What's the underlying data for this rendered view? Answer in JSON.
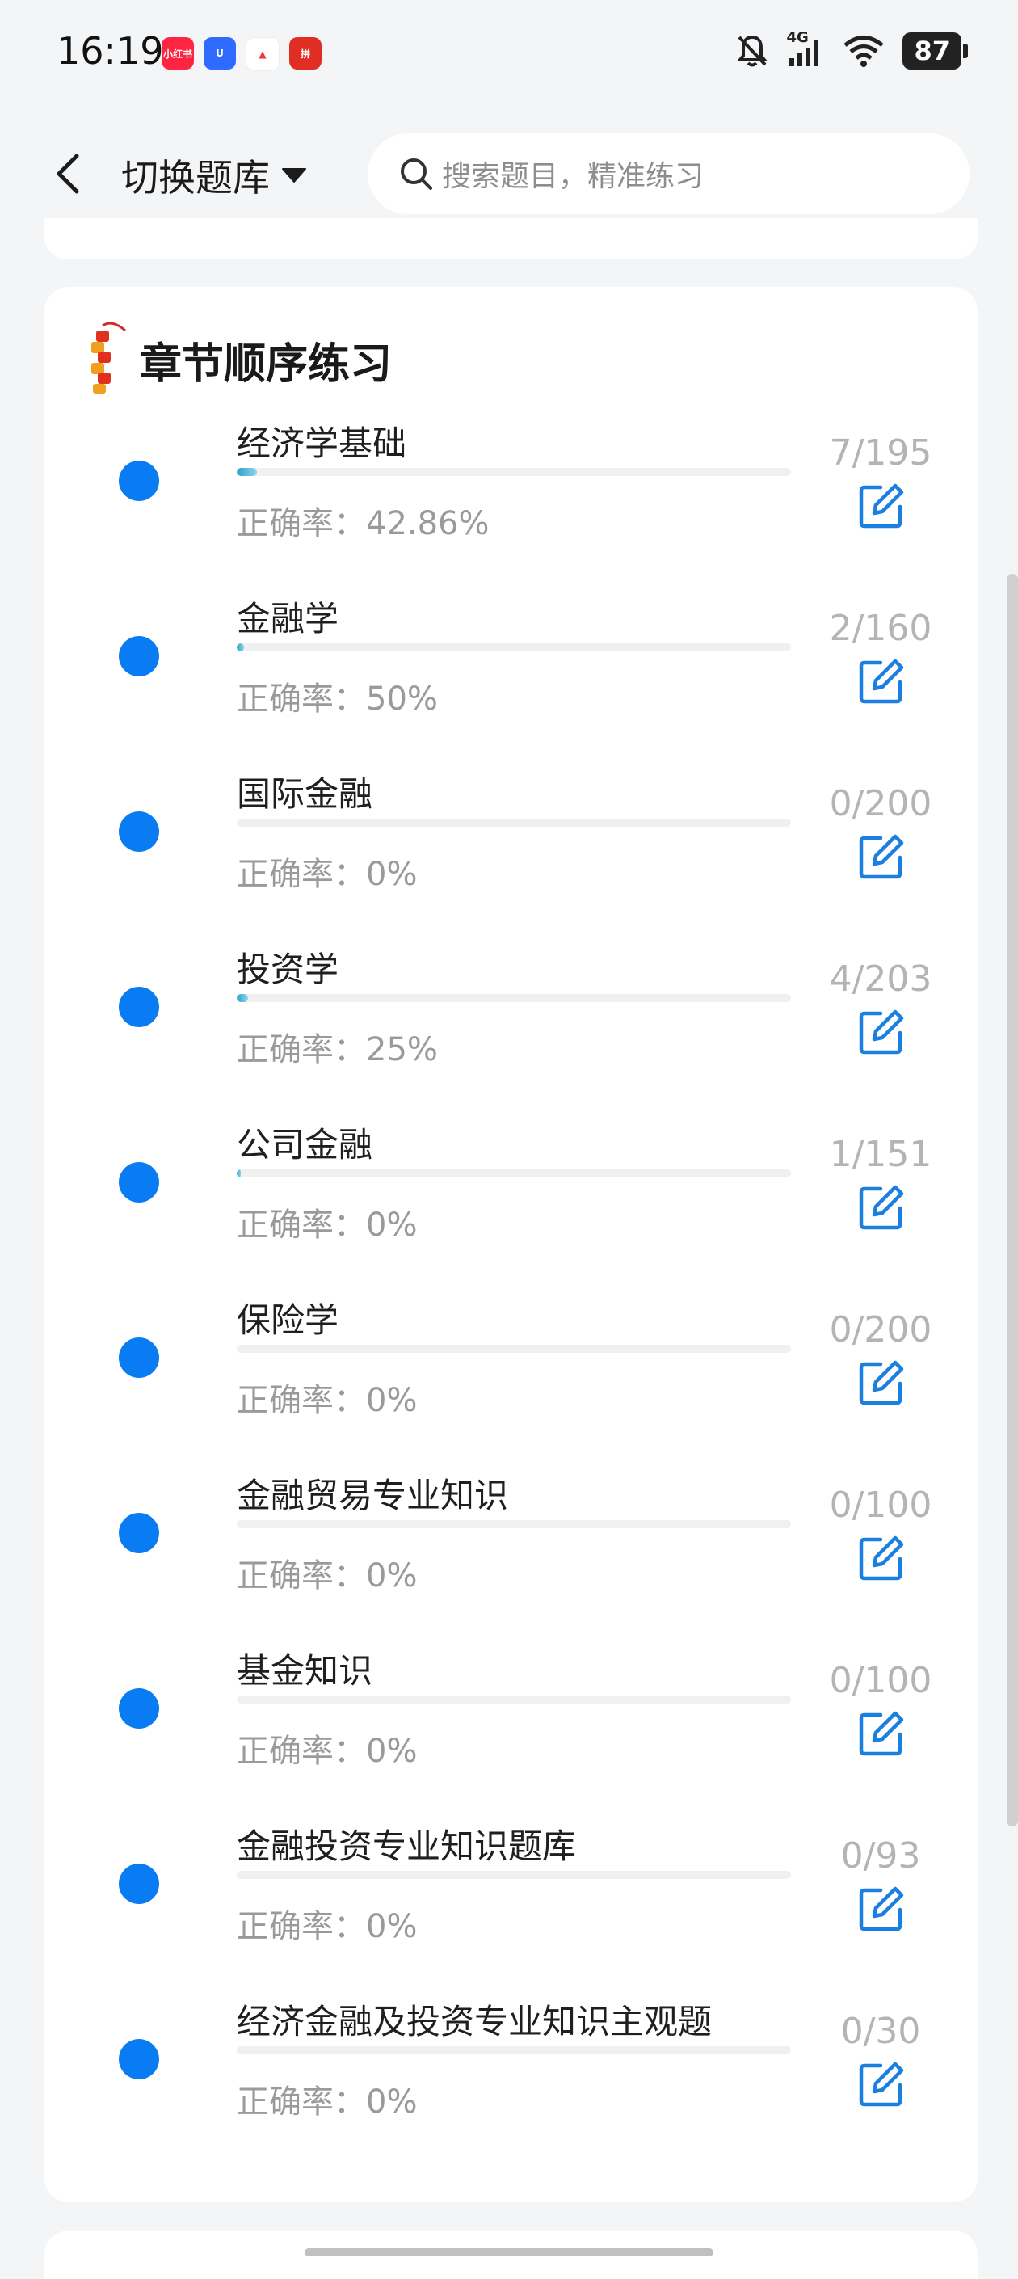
{
  "status_bar": {
    "time": "16:19",
    "network": "4G",
    "battery": "87",
    "app_icons": [
      {
        "name": "xiaohongshu-app-icon",
        "color": "#ff2442",
        "label": "小红书"
      },
      {
        "name": "blue-u-app-icon",
        "color": "#2f6bff",
        "label": "U"
      },
      {
        "name": "red-mountain-app-icon",
        "color": "#ffffff",
        "label": "▲"
      },
      {
        "name": "pinduoduo-app-icon",
        "color": "#e02e24",
        "label": "拼"
      }
    ]
  },
  "header": {
    "switch_label": "切换题库",
    "search_placeholder": "搜索题目，精准练习"
  },
  "section": {
    "title": "章节顺序练习"
  },
  "colors": {
    "accent": "#0a7cf3",
    "progress": "#2aa4c9",
    "muted_text": "#9a9a9a"
  },
  "chapters": [
    {
      "name": "经济学基础",
      "accuracy": "正确率：42.86%",
      "count": "7/195",
      "done": 7,
      "total": 195
    },
    {
      "name": "金融学",
      "accuracy": "正确率：50%",
      "count": "2/160",
      "done": 2,
      "total": 160
    },
    {
      "name": "国际金融",
      "accuracy": "正确率：0%",
      "count": "0/200",
      "done": 0,
      "total": 200
    },
    {
      "name": "投资学",
      "accuracy": "正确率：25%",
      "count": "4/203",
      "done": 4,
      "total": 203
    },
    {
      "name": "公司金融",
      "accuracy": "正确率：0%",
      "count": "1/151",
      "done": 1,
      "total": 151
    },
    {
      "name": "保险学",
      "accuracy": "正确率：0%",
      "count": "0/200",
      "done": 0,
      "total": 200
    },
    {
      "name": "金融贸易专业知识",
      "accuracy": "正确率：0%",
      "count": "0/100",
      "done": 0,
      "total": 100
    },
    {
      "name": "基金知识",
      "accuracy": "正确率：0%",
      "count": "0/100",
      "done": 0,
      "total": 100
    },
    {
      "name": "金融投资专业知识题库",
      "accuracy": "正确率：0%",
      "count": "0/93",
      "done": 0,
      "total": 93
    },
    {
      "name": "经济金融及投资专业知识主观题",
      "accuracy": "正确率：0%",
      "count": "0/30",
      "done": 0,
      "total": 30
    }
  ]
}
